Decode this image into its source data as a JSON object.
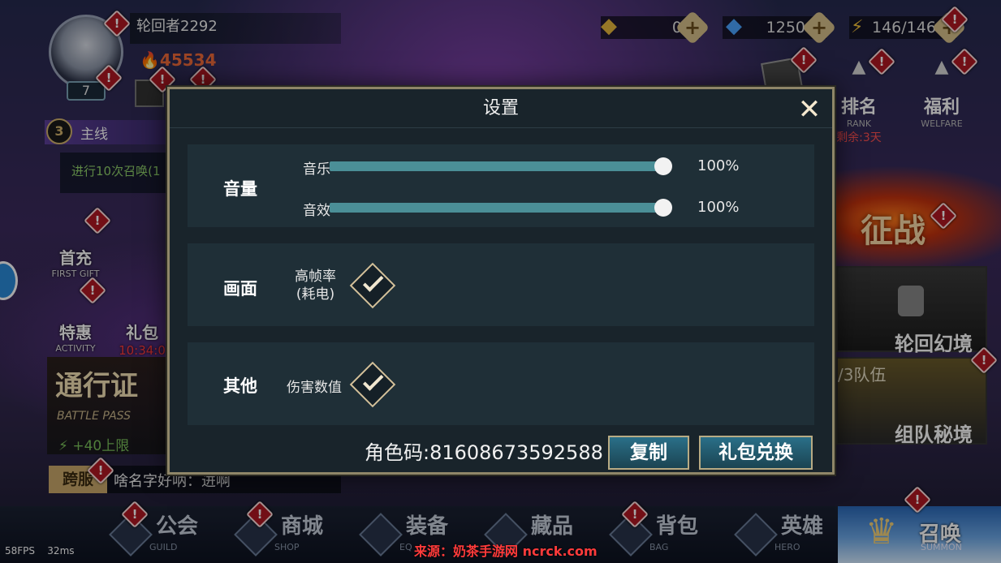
{
  "player": {
    "name": "轮回者2292",
    "level": "7",
    "power": "45534"
  },
  "quest": {
    "tab": "主线",
    "badge": "3",
    "text": "进行10次召唤(1"
  },
  "side": {
    "first_gift": {
      "label": "首充",
      "sub": "FIRST GIFT"
    },
    "activity": {
      "label": "特惠",
      "sub": "ACTIVITY"
    },
    "gift": {
      "label": "礼包",
      "timer": "10:34:0"
    },
    "pass": {
      "title": "通行证",
      "sub": "BATTLE PASS",
      "bonus": "+40上限"
    },
    "cross": {
      "tag": "跨服",
      "text": "啥名字好呐：进啊"
    }
  },
  "resources": {
    "gold": "0",
    "diamond": "1250",
    "energy": "146/146"
  },
  "topright": {
    "rank": {
      "label": "排名",
      "sub": "RANK",
      "remain": "剩余:3天"
    },
    "welfare": {
      "label": "福利",
      "sub": "WELFARE"
    }
  },
  "cards": {
    "battle": "征战",
    "rebirth": "轮回幻境",
    "team": {
      "count": "/3队伍",
      "label": "组队秘境"
    }
  },
  "nav": [
    {
      "label": "公会",
      "sub": "GUILD"
    },
    {
      "label": "商城",
      "sub": "SHOP"
    },
    {
      "label": "装备",
      "sub": "EQ"
    },
    {
      "label": "藏品",
      "sub": ""
    },
    {
      "label": "背包",
      "sub": "BAG"
    },
    {
      "label": "英雄",
      "sub": "HERO"
    },
    {
      "label": "召唤",
      "sub": "SUMMON"
    }
  ],
  "settings": {
    "title": "设置",
    "volume": {
      "section": "音量",
      "music_label": "音乐",
      "music_value": "100%",
      "sfx_label": "音效",
      "sfx_value": "100%",
      "music_level": 1.0,
      "sfx_level": 1.0
    },
    "display": {
      "section": "画面",
      "hfr_label_1": "高帧率",
      "hfr_label_2": "(耗电)",
      "hfr_checked": true
    },
    "other": {
      "section": "其他",
      "damage_label": "伤害数值",
      "damage_checked": true
    },
    "role_code": "角色码:81608673592588",
    "copy_label": "复制",
    "redeem_label": "礼包兑换"
  },
  "status": {
    "fps": "58FPS",
    "ms": "32ms"
  },
  "watermark": "来源：奶茶手游网 ncrck.com",
  "alert_glyph": "!",
  "colors": {
    "accent": "#4b8f97",
    "gold": "#d4c19a",
    "alert": "#b01822"
  }
}
